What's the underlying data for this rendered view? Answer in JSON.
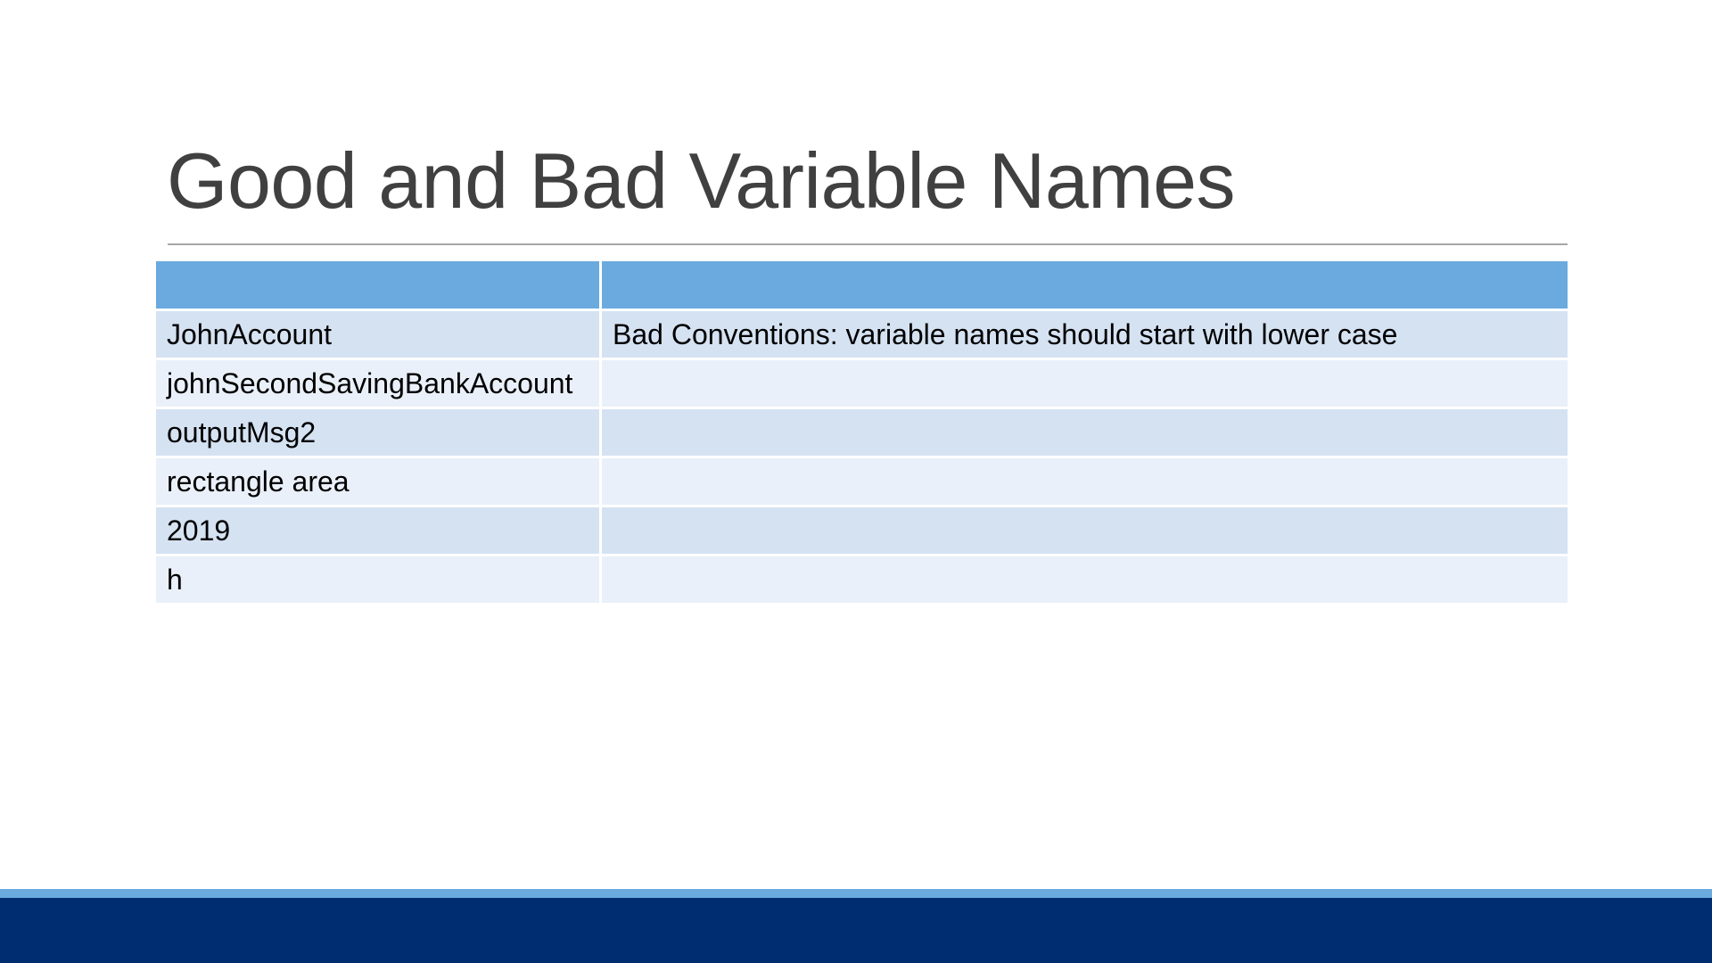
{
  "slide": {
    "title": "Good and Bad Variable Names"
  },
  "table": {
    "headers": [
      "",
      ""
    ],
    "rows": [
      {
        "name": "JohnAccount",
        "comment": "Bad Conventions: variable names should start with lower case"
      },
      {
        "name": "johnSecondSavingBankAccount",
        "comment": ""
      },
      {
        "name": "outputMsg2",
        "comment": ""
      },
      {
        "name": "rectangle area",
        "comment": ""
      },
      {
        "name": "2019",
        "comment": ""
      },
      {
        "name": "h",
        "comment": ""
      }
    ]
  },
  "colors": {
    "header": "#6aaade",
    "row_odd": "#d5e2f2",
    "row_even": "#eaf0f9",
    "footer_stripe": "#6aaade",
    "footer_bar": "#002d72"
  }
}
